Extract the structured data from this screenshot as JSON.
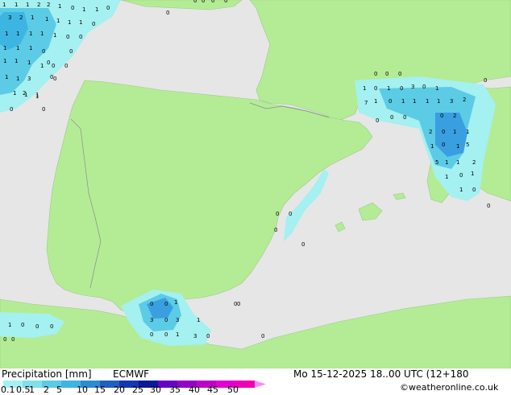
{
  "title": {
    "product": "Precipitation [mm]",
    "model": "ECMWF",
    "datetime": "Mo 15-12-2025 18..00 UTC (12+180",
    "credit": "©weatheronline.co.uk"
  },
  "legend": {
    "labels": [
      "0.1",
      "0.5",
      "1",
      "2",
      "5",
      "10",
      "15",
      "20",
      "25",
      "30",
      "35",
      "40",
      "45",
      "50"
    ],
    "colors": [
      "#a5f0f0",
      "#7fe0ea",
      "#5ccbe6",
      "#3db5e3",
      "#2a8cd2",
      "#1e5fc0",
      "#1438b0",
      "#0a1a96",
      "#6a00c8",
      "#9600c8",
      "#be00c8",
      "#e100d2",
      "#f000b4",
      "#f08cf0"
    ]
  },
  "colors": {
    "sea": "#e6e6e6",
    "land": "#b4ec96",
    "light_precip": "#a5f0f0",
    "medium_precip": "#5ccbe6",
    "heavy_precip": "#3a9fe0",
    "border": "#8c8c8c"
  },
  "map_points": [
    {
      "label": "1"
    },
    {
      "label": "1"
    },
    {
      "label": "1"
    },
    {
      "label": "2"
    },
    {
      "label": "2"
    },
    {
      "label": "1"
    },
    {
      "label": "0"
    },
    {
      "label": "1"
    },
    {
      "label": "1"
    },
    {
      "label": "0"
    },
    {
      "label": "0"
    },
    {
      "label": "0"
    },
    {
      "label": "3"
    },
    {
      "label": "2"
    },
    {
      "label": "1"
    },
    {
      "label": "1"
    },
    {
      "label": "1"
    },
    {
      "label": "1"
    },
    {
      "label": "1"
    },
    {
      "label": "0"
    },
    {
      "label": "1"
    },
    {
      "label": "1"
    },
    {
      "label": "1"
    },
    {
      "label": "1"
    },
    {
      "label": "1"
    },
    {
      "label": "0"
    },
    {
      "label": "0"
    },
    {
      "label": "1"
    },
    {
      "label": "1"
    },
    {
      "label": "1"
    },
    {
      "label": "0"
    },
    {
      "label": "0"
    },
    {
      "label": "1"
    },
    {
      "label": "1"
    },
    {
      "label": "1"
    },
    {
      "label": "1"
    },
    {
      "label": "0"
    },
    {
      "label": "1"
    },
    {
      "label": "1"
    },
    {
      "label": "3"
    },
    {
      "label": "0"
    },
    {
      "label": "0"
    },
    {
      "label": "1"
    },
    {
      "label": "2"
    },
    {
      "label": "1"
    },
    {
      "label": "0"
    },
    {
      "label": "0"
    },
    {
      "label": "1"
    },
    {
      "label": "1"
    },
    {
      "label": "0"
    },
    {
      "label": "0"
    },
    {
      "label": "0"
    },
    {
      "label": "0"
    },
    {
      "label": "0"
    },
    {
      "label": "0"
    },
    {
      "label": "0"
    },
    {
      "label": "0"
    },
    {
      "label": "1"
    },
    {
      "label": "0"
    },
    {
      "label": "1"
    },
    {
      "label": "0"
    },
    {
      "label": "3"
    },
    {
      "label": "0"
    },
    {
      "label": "1"
    },
    {
      "label": "0"
    },
    {
      "label": "1"
    },
    {
      "label": "0"
    },
    {
      "label": "1"
    },
    {
      "label": "1"
    },
    {
      "label": "1"
    },
    {
      "label": "1"
    },
    {
      "label": "3"
    },
    {
      "label": "2"
    },
    {
      "label": "7"
    },
    {
      "label": "0"
    },
    {
      "label": "0"
    },
    {
      "label": "0"
    },
    {
      "label": "0"
    },
    {
      "label": "2"
    },
    {
      "label": "2"
    },
    {
      "label": "0"
    },
    {
      "label": "1"
    },
    {
      "label": "1"
    },
    {
      "label": "1"
    },
    {
      "label": "0"
    },
    {
      "label": "1"
    },
    {
      "label": "5"
    },
    {
      "label": "5"
    },
    {
      "label": "1"
    },
    {
      "label": "1"
    },
    {
      "label": "2"
    },
    {
      "label": "1"
    },
    {
      "label": "0"
    },
    {
      "label": "1"
    },
    {
      "label": "1"
    },
    {
      "label": "0"
    },
    {
      "label": "0"
    },
    {
      "label": "0"
    },
    {
      "label": "0"
    },
    {
      "label": "0"
    },
    {
      "label": "0"
    },
    {
      "label": "0"
    },
    {
      "label": "0"
    },
    {
      "label": "0"
    },
    {
      "label": "1"
    },
    {
      "label": "3"
    },
    {
      "label": "0"
    },
    {
      "label": "3"
    },
    {
      "label": "0"
    },
    {
      "label": "0"
    },
    {
      "label": "1"
    },
    {
      "label": "3"
    },
    {
      "label": "0"
    },
    {
      "label": "1"
    },
    {
      "label": "1"
    },
    {
      "label": "0"
    },
    {
      "label": "0"
    },
    {
      "label": "0"
    },
    {
      "label": "0"
    },
    {
      "label": "0"
    },
    {
      "label": "0"
    },
    {
      "label": "0"
    },
    {
      "label": "1"
    },
    {
      "label": "0"
    }
  ]
}
